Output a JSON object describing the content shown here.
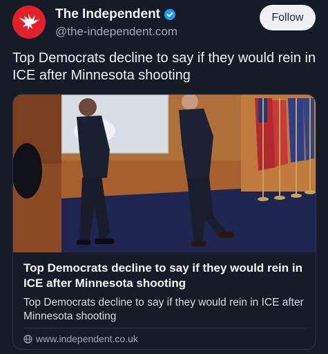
{
  "account": {
    "display_name": "The Independent",
    "handle": "@the-independent.com",
    "verified_icon": "verified-check-icon",
    "avatar_icon": "eagle-logo-icon",
    "avatar_color": "#e0202b"
  },
  "actions": {
    "follow_label": "Follow"
  },
  "post": {
    "text": "Top Democrats decline to say if they would rein in ICE after Minnesota shooting"
  },
  "link_card": {
    "image_icon": "press-photo",
    "title": "Top Democrats decline to say if they would rein in ICE after Minnesota shooting",
    "description": "Top Democrats decline to say if they would rein in ICE after Minnesota shooting",
    "domain": "www.independent.co.uk",
    "domain_icon": "globe-icon"
  },
  "colors": {
    "background": "#151b27",
    "verified": "#1d9bf0",
    "muted_text": "#a3abb8"
  }
}
